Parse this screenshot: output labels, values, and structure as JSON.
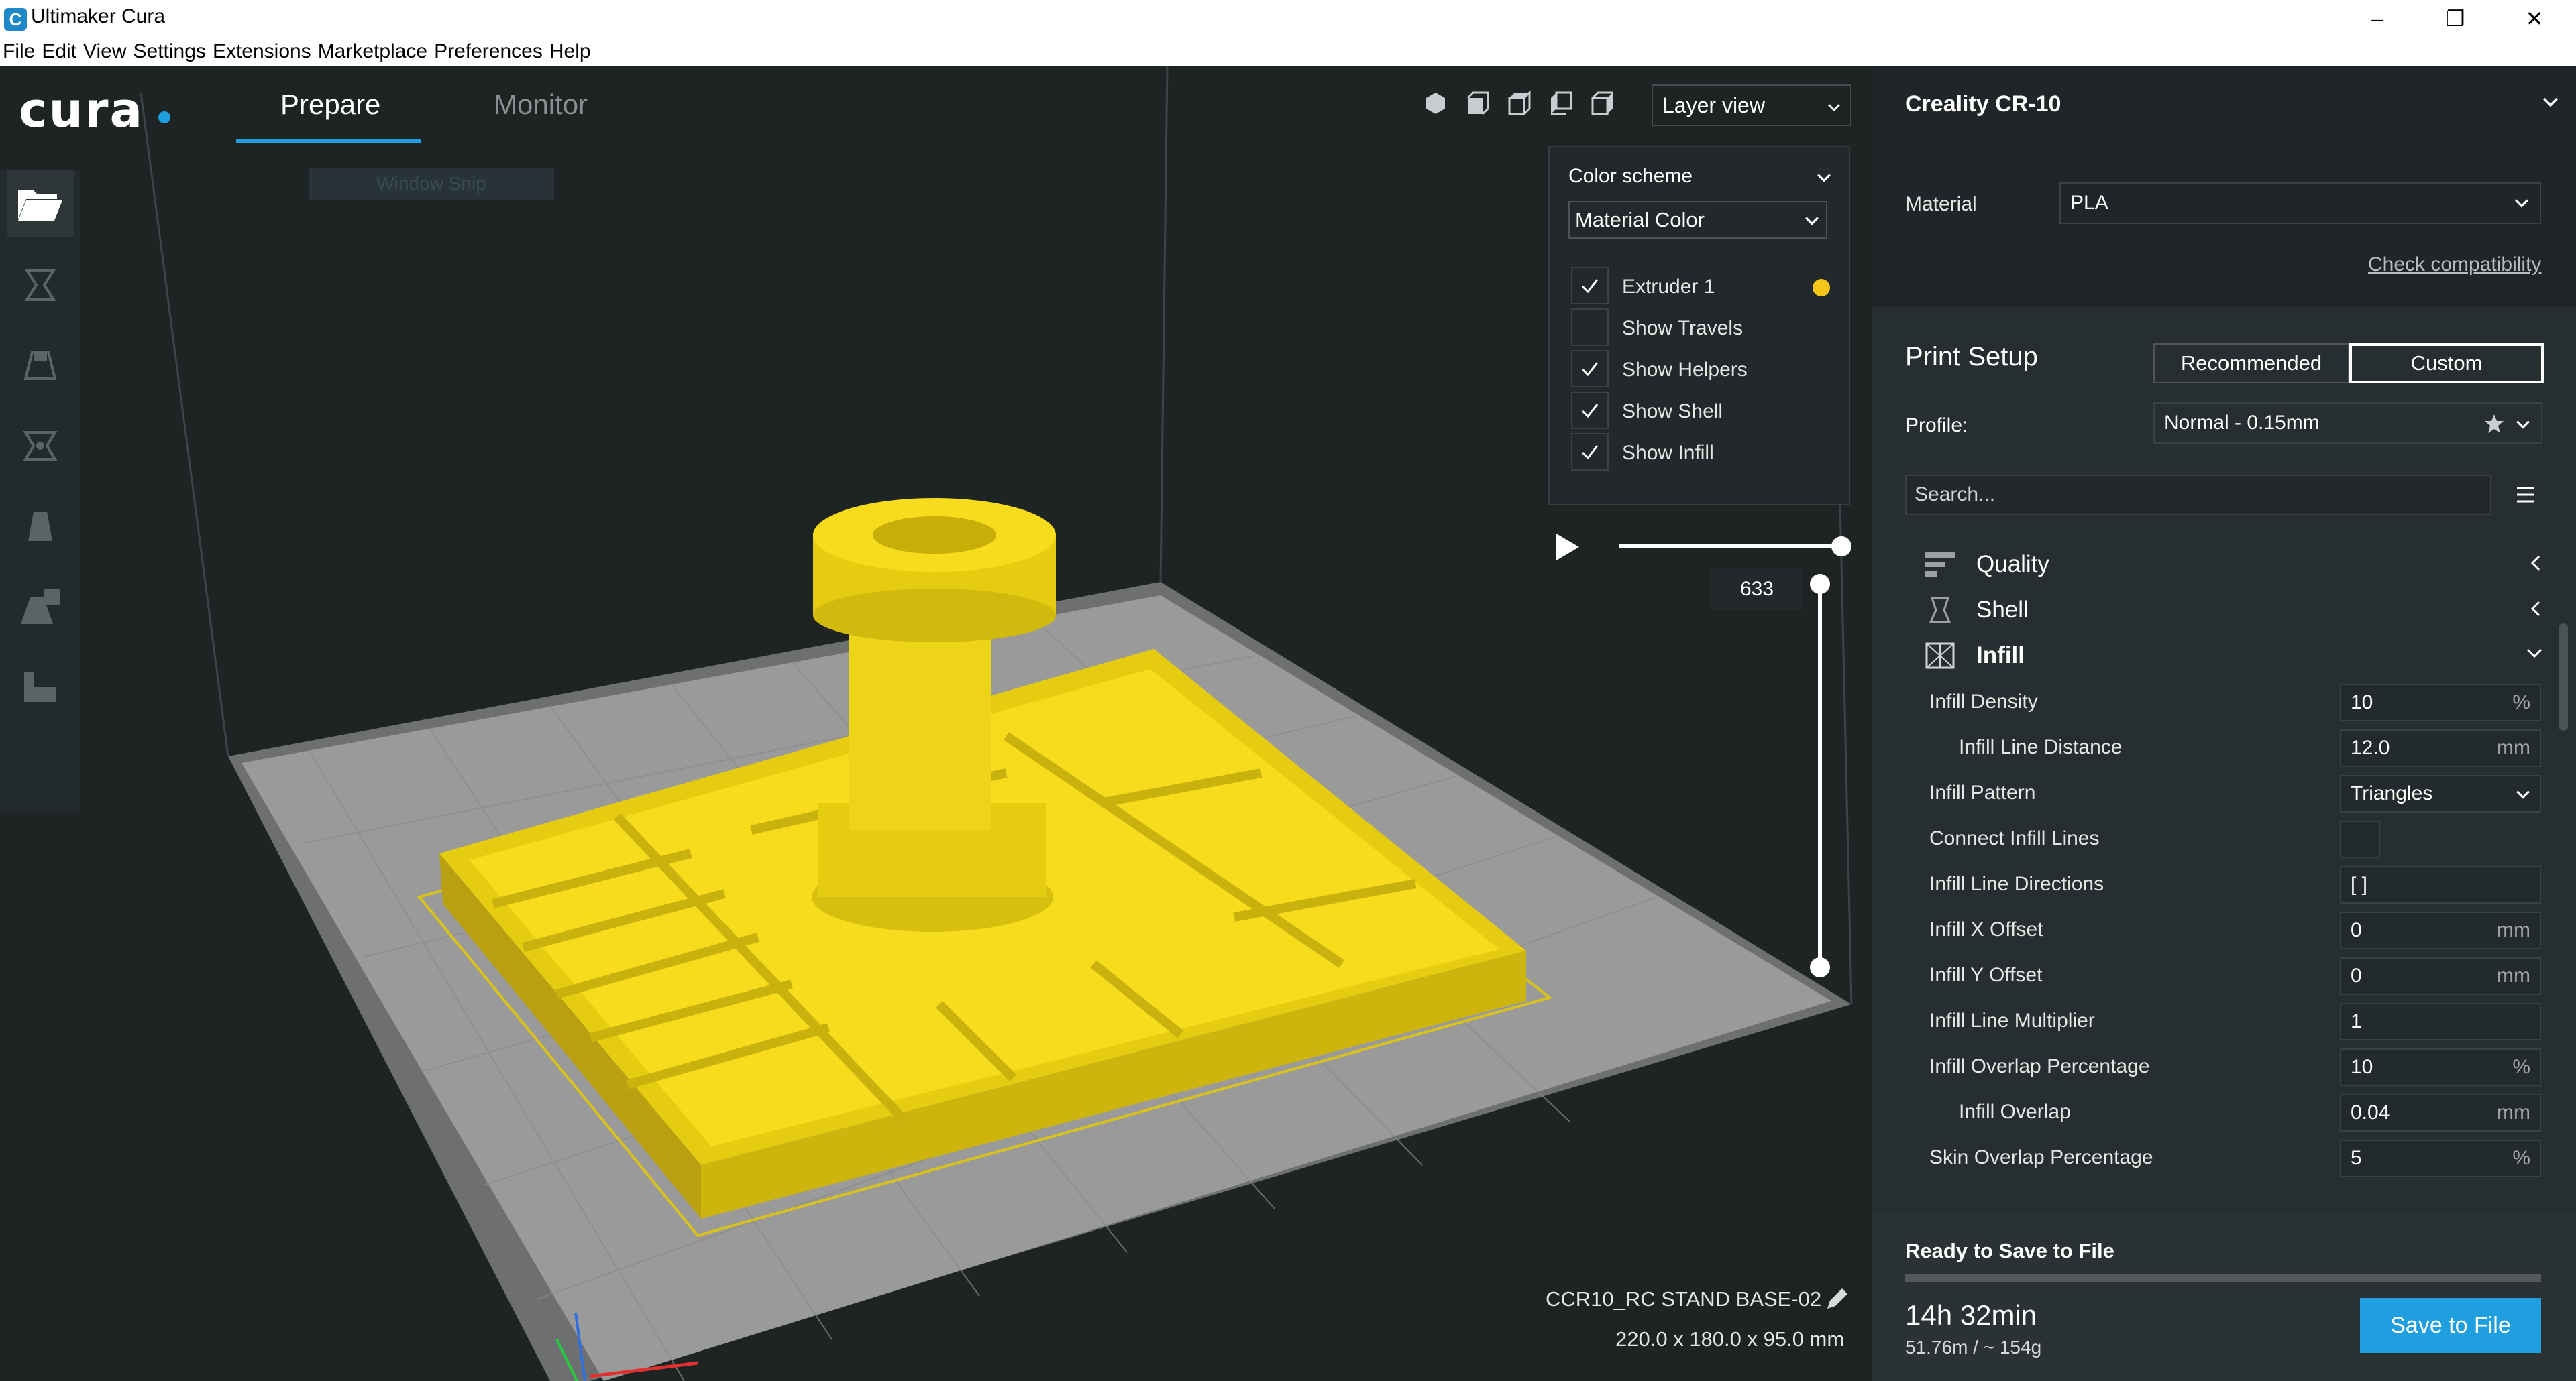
{
  "window": {
    "app_icon_letter": "C",
    "title": "Ultimaker Cura"
  },
  "menu": [
    "File",
    "Edit",
    "View",
    "Settings",
    "Extensions",
    "Marketplace",
    "Preferences",
    "Help"
  ],
  "header": {
    "logo": "cura",
    "tabs": [
      {
        "label": "Prepare",
        "active": true
      },
      {
        "label": "Monitor",
        "active": false
      }
    ],
    "view_mode": "Layer view",
    "window_snip": "Window Snip"
  },
  "toolbar": {
    "tools": [
      "open-folder-icon",
      "move-icon",
      "scale-icon",
      "rotate-icon",
      "mirror-icon",
      "per-model-settings-icon",
      "support-blocker-icon"
    ]
  },
  "color_panel": {
    "title": "Color scheme",
    "scheme": "Material Color",
    "options": [
      {
        "label": "Extruder 1",
        "checked": true,
        "color": "#f6c51a"
      },
      {
        "label": "Show Travels",
        "checked": false
      },
      {
        "label": "Show Helpers",
        "checked": true
      },
      {
        "label": "Show Shell",
        "checked": true
      },
      {
        "label": "Show Infill",
        "checked": true
      }
    ]
  },
  "layer_slider": {
    "current_layer": "633"
  },
  "job": {
    "name": "CCR10_RC STAND BASE-02",
    "dimensions": "220.0 x 180.0 x 95.0 mm"
  },
  "printer": {
    "name": "Creality CR-10"
  },
  "material": {
    "label": "Material",
    "value": "PLA",
    "compat_link": "Check compatibility"
  },
  "print_setup": {
    "title": "Print Setup",
    "mode_recommended": "Recommended",
    "mode_custom": "Custom",
    "profile_label": "Profile:",
    "profile_value": "Normal - 0.15mm",
    "search_placeholder": "Search...",
    "categories": [
      "Quality",
      "Shell",
      "Infill"
    ],
    "settings": [
      {
        "label": "Infill Density",
        "value": "10",
        "unit": "%"
      },
      {
        "label": "Infill Line Distance",
        "value": "12.0",
        "unit": "mm"
      },
      {
        "label": "Infill Pattern",
        "value": "Triangles",
        "unit": ""
      },
      {
        "label": "Connect Infill Lines",
        "value": "",
        "unit": ""
      },
      {
        "label": "Infill Line Directions",
        "value": "[ ]",
        "unit": ""
      },
      {
        "label": "Infill X Offset",
        "value": "0",
        "unit": "mm"
      },
      {
        "label": "Infill Y Offset",
        "value": "0",
        "unit": "mm"
      },
      {
        "label": "Infill Line Multiplier",
        "value": "1",
        "unit": ""
      },
      {
        "label": "Infill Overlap Percentage",
        "value": "10",
        "unit": "%"
      },
      {
        "label": "Infill Overlap",
        "value": "0.04",
        "unit": "mm"
      },
      {
        "label": "Skin Overlap Percentage",
        "value": "5",
        "unit": "%"
      }
    ]
  },
  "save": {
    "status": "Ready to Save to File",
    "time": "14h 32min",
    "material_usage": "51.76m / ~ 154g",
    "button": "Save to File"
  },
  "colors": {
    "accent": "#1f9fe0",
    "model_yellow": "#f6dc1c",
    "panel_bg": "#272e30",
    "viewport_bg": "#1e2323"
  }
}
